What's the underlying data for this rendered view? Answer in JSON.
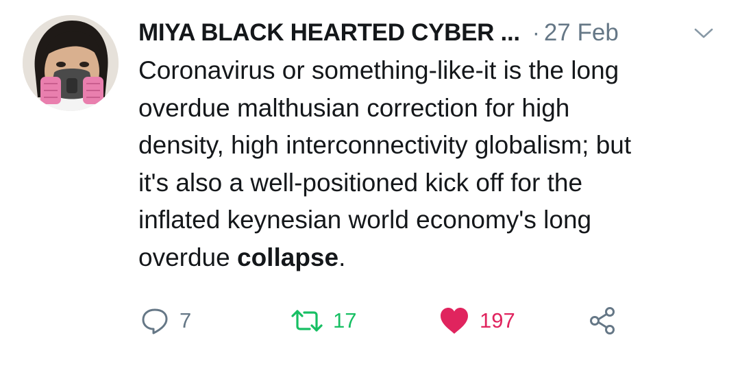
{
  "tweet": {
    "display_name": "MIYA BLACK HEARTED CYBER ...",
    "separator": "·",
    "date": "27 Feb",
    "text_main": "Coronavirus or something-like-it is the long\noverdue malthusian correction for high\ndensity, high interconnectivity globalism; but\nit's also a well-positioned kick off for the\ninflated keynesian world economy's long\noverdue ",
    "text_bold": "collapse",
    "text_end": "."
  },
  "actions": {
    "reply_count": "7",
    "retweet_count": "17",
    "like_count": "197"
  },
  "icons": {
    "reply": "reply-bubble-icon",
    "retweet": "retweet-arrows-icon",
    "like": "heart-icon",
    "share": "share-nodes-icon",
    "more": "chevron-down-icon"
  },
  "colors": {
    "text": "#14171a",
    "secondary": "#657786",
    "retweet": "#17bf63",
    "like": "#e0245e"
  }
}
